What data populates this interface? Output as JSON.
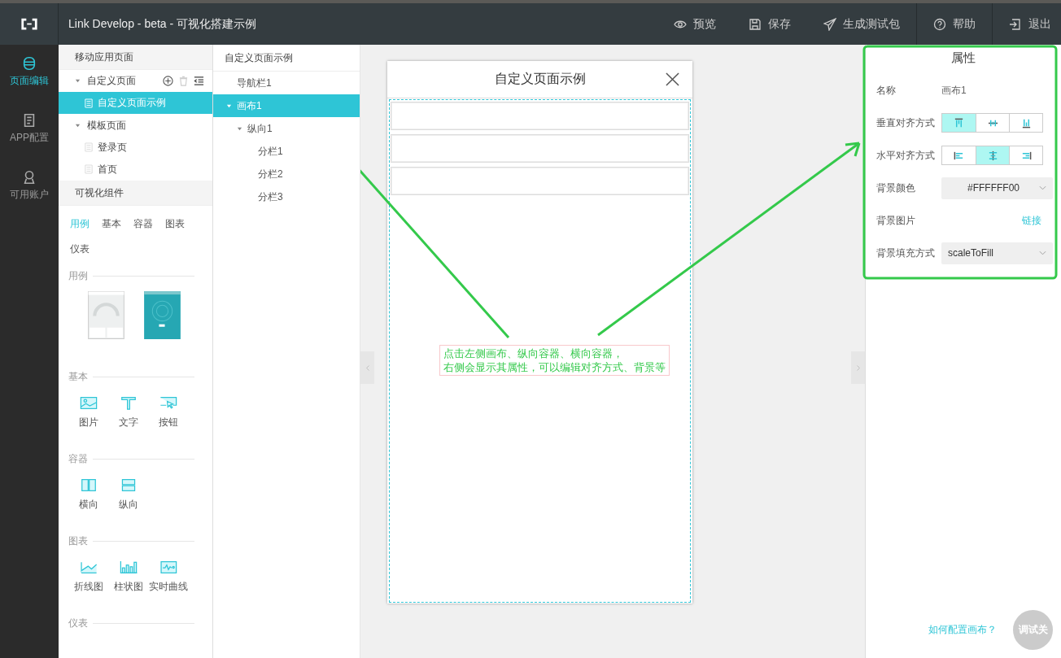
{
  "header": {
    "title": "Link Develop - beta - 可视化搭建示例",
    "actions": [
      {
        "label": "预览"
      },
      {
        "label": "保存"
      },
      {
        "label": "生成测试包"
      },
      {
        "label": "帮助"
      },
      {
        "label": "退出"
      }
    ]
  },
  "nav": [
    {
      "label": "页面编辑",
      "selected": true
    },
    {
      "label": "APP配置",
      "selected": false
    },
    {
      "label": "可用账户",
      "selected": false
    }
  ],
  "pages_panel": {
    "title": "移动应用页面",
    "groups": [
      {
        "label": "自定义页面",
        "expanded": true,
        "tools": true,
        "children": [
          {
            "label": "自定义页面示例",
            "selected": true
          }
        ]
      },
      {
        "label": "模板页面",
        "expanded": true,
        "tools": false,
        "children": [
          {
            "label": "登录页",
            "selected": false
          },
          {
            "label": "首页",
            "selected": false
          }
        ]
      }
    ]
  },
  "components_panel": {
    "title": "可视化组件",
    "tabs": [
      {
        "label": "用例",
        "selected": true
      },
      {
        "label": "基本",
        "selected": false
      },
      {
        "label": "容器",
        "selected": false
      },
      {
        "label": "图表",
        "selected": false
      },
      {
        "label": "仪表",
        "selected": false
      }
    ],
    "sections": [
      {
        "title": "用例",
        "kind": "thumbs",
        "items": [
          {
            "kind": "gauge"
          },
          {
            "kind": "teal"
          }
        ]
      },
      {
        "title": "基本",
        "kind": "icons",
        "items": [
          {
            "label": "图片",
            "kind": "image"
          },
          {
            "label": "文字",
            "kind": "text"
          },
          {
            "label": "按钮",
            "kind": "button"
          }
        ]
      },
      {
        "title": "容器",
        "kind": "icons",
        "items": [
          {
            "label": "横向",
            "kind": "cols"
          },
          {
            "label": "纵向",
            "kind": "rows"
          }
        ]
      },
      {
        "title": "图表",
        "kind": "icons",
        "items": [
          {
            "label": "折线图",
            "kind": "line"
          },
          {
            "label": "柱状图",
            "kind": "bar"
          },
          {
            "label": "实时曲线",
            "kind": "wave"
          }
        ]
      },
      {
        "title": "仪表",
        "kind": "icons"
      }
    ]
  },
  "tree_panel": {
    "title": "自定义页面示例",
    "nodes": [
      {
        "label": "导航栏1",
        "selected": false
      },
      {
        "label": "画布1",
        "selected": true,
        "expanded": true,
        "children": [
          {
            "label": "纵向1",
            "selected": false,
            "expanded": true,
            "children": [
              {
                "label": "分栏1",
                "selected": false
              },
              {
                "label": "分栏2",
                "selected": false
              },
              {
                "label": "分栏3",
                "selected": false
              }
            ]
          }
        ]
      }
    ]
  },
  "phone": {
    "title": "自定义页面示例"
  },
  "annotation": {
    "lines": [
      "点击左侧画布、纵向容器、横向容器，",
      "右侧会显示其属性，可以编辑对齐方式、背景等"
    ]
  },
  "properties": {
    "title": "属性",
    "name": {
      "label": "名称",
      "value": "画布1"
    },
    "vertical_align": {
      "label": "垂直对齐方式",
      "options": [
        {
          "kind": "top",
          "selected": true
        },
        {
          "kind": "middle",
          "selected": false
        },
        {
          "kind": "bottom",
          "selected": false
        }
      ]
    },
    "horizontal_align": {
      "label": "水平对齐方式",
      "options": [
        {
          "kind": "left",
          "selected": false
        },
        {
          "kind": "center",
          "selected": true
        },
        {
          "kind": "right",
          "selected": false
        }
      ]
    },
    "background_color": {
      "label": "背景颜色",
      "value": "#FFFFFF00"
    },
    "background_image": {
      "label": "背景图片",
      "link": "链接"
    },
    "background_fill": {
      "label": "背景填充方式",
      "value": "scaleToFill"
    }
  },
  "help_link": "如何配置画布？",
  "debug_button": "调试关"
}
